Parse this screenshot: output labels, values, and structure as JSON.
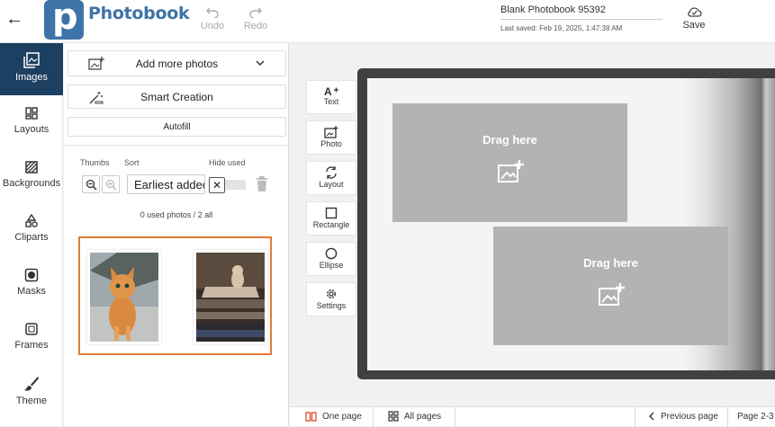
{
  "header": {
    "brand": "Photobook",
    "logo_letter": "p",
    "undo_label": "Undo",
    "redo_label": "Redo",
    "doc_title": "Blank Photobook 95392",
    "last_saved": "Last saved: Feb 19, 2025, 1:47:38 AM",
    "save_label": "Save"
  },
  "nav": {
    "items": [
      {
        "label": "Images",
        "icon": "images-icon"
      },
      {
        "label": "Layouts",
        "icon": "layouts-icon"
      },
      {
        "label": "Backgrounds",
        "icon": "backgrounds-icon"
      },
      {
        "label": "Cliparts",
        "icon": "cliparts-icon"
      },
      {
        "label": "Masks",
        "icon": "masks-icon"
      },
      {
        "label": "Frames",
        "icon": "frames-icon"
      },
      {
        "label": "Theme",
        "icon": "brush-icon"
      }
    ]
  },
  "panel": {
    "add_photos": "Add more photos",
    "smart_creation": "Smart Creation",
    "autofill": "Autofill",
    "thumbs_label": "Thumbs",
    "sort_label": "Sort",
    "hide_used_label": "Hide used",
    "sort_value": "Earliest added",
    "counter": "0 used photos / 2 all",
    "photos": [
      "cat-photo-1",
      "cat-photo-2"
    ]
  },
  "tools": [
    {
      "label": "Text",
      "icon": "text-icon"
    },
    {
      "label": "Photo",
      "icon": "photo-icon"
    },
    {
      "label": "Layout",
      "icon": "layout-icon"
    },
    {
      "label": "Rectangle",
      "icon": "rectangle-icon"
    },
    {
      "label": "Ellipse",
      "icon": "ellipse-icon"
    },
    {
      "label": "Settings",
      "icon": "gear-icon"
    }
  ],
  "canvas": {
    "drop_zones": [
      "Drag here",
      "Drag here"
    ]
  },
  "footer": {
    "one_page": "One page",
    "all_pages": "All pages",
    "previous_page": "Previous page",
    "page_indicator": "Page 2-3"
  },
  "colors": {
    "accent": "#3e73a8",
    "nav_active": "#1d3f61",
    "selection": "#e37a37"
  }
}
